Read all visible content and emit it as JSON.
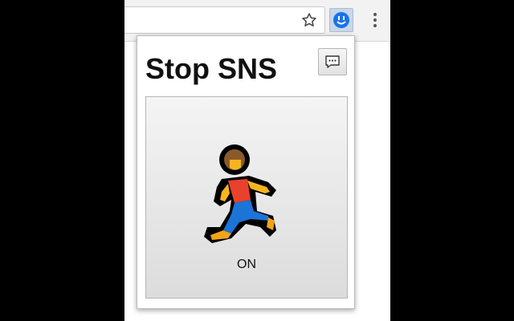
{
  "browser": {
    "bookmark_icon": "star-icon",
    "extension_icon": "smiley-icon",
    "menu_icon": "more-vertical-icon"
  },
  "popup": {
    "title": "Stop SNS",
    "feedback_icon": "speech-bubble-icon",
    "toggle": {
      "icon": "running-person-icon",
      "state_label": "ON"
    }
  },
  "colors": {
    "extension_icon_blue": "#1a73e8",
    "runner_shirt": "#e8412c",
    "runner_pants": "#1c74d6",
    "runner_skin": "#f6b51e",
    "runner_hair": "#8a5a2b"
  }
}
